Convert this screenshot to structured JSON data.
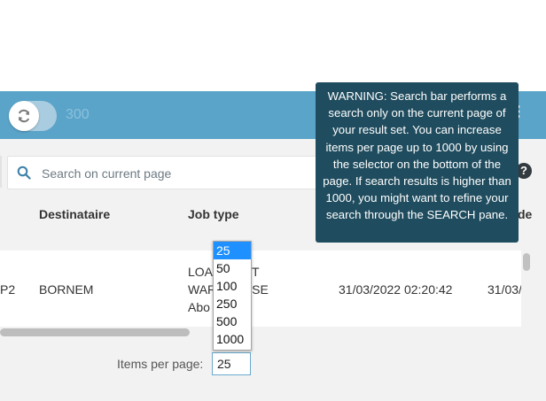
{
  "toolbar": {
    "count": "300",
    "refresh_icon": "refresh-icon",
    "menu_icon": "kebab-menu-icon",
    "accent": "#5aa4c9"
  },
  "search": {
    "placeholder": "Search on current page",
    "value": "",
    "icon": "search-icon"
  },
  "help_icon": "?",
  "tooltip": {
    "text": "WARNING: Search bar performs a search only on the current page of your result set. You can increase items per page up to 1000 by using the selector on the bottom of the page. If search results is higher than 1000, you might want to refine your search through the SEARCH pane."
  },
  "table": {
    "headers": {
      "destinataire": "Destinataire",
      "job_type": "Job type",
      "partial": "de"
    },
    "rows": [
      {
        "id_partial": "P2",
        "destinataire": "BORNEM",
        "job_type_lines": [
          "LOA",
          "WAR",
          "Abo"
        ],
        "job_type_tails": [
          "T",
          "SE",
          "o"
        ],
        "date1": "31/03/2022 02:20:42",
        "date2_partial": "31/03/"
      }
    ]
  },
  "pagination": {
    "label": "Items per page:",
    "selected": "25",
    "options": [
      "25",
      "50",
      "100",
      "250",
      "500",
      "1000"
    ],
    "highlight": "#1e90ff"
  }
}
